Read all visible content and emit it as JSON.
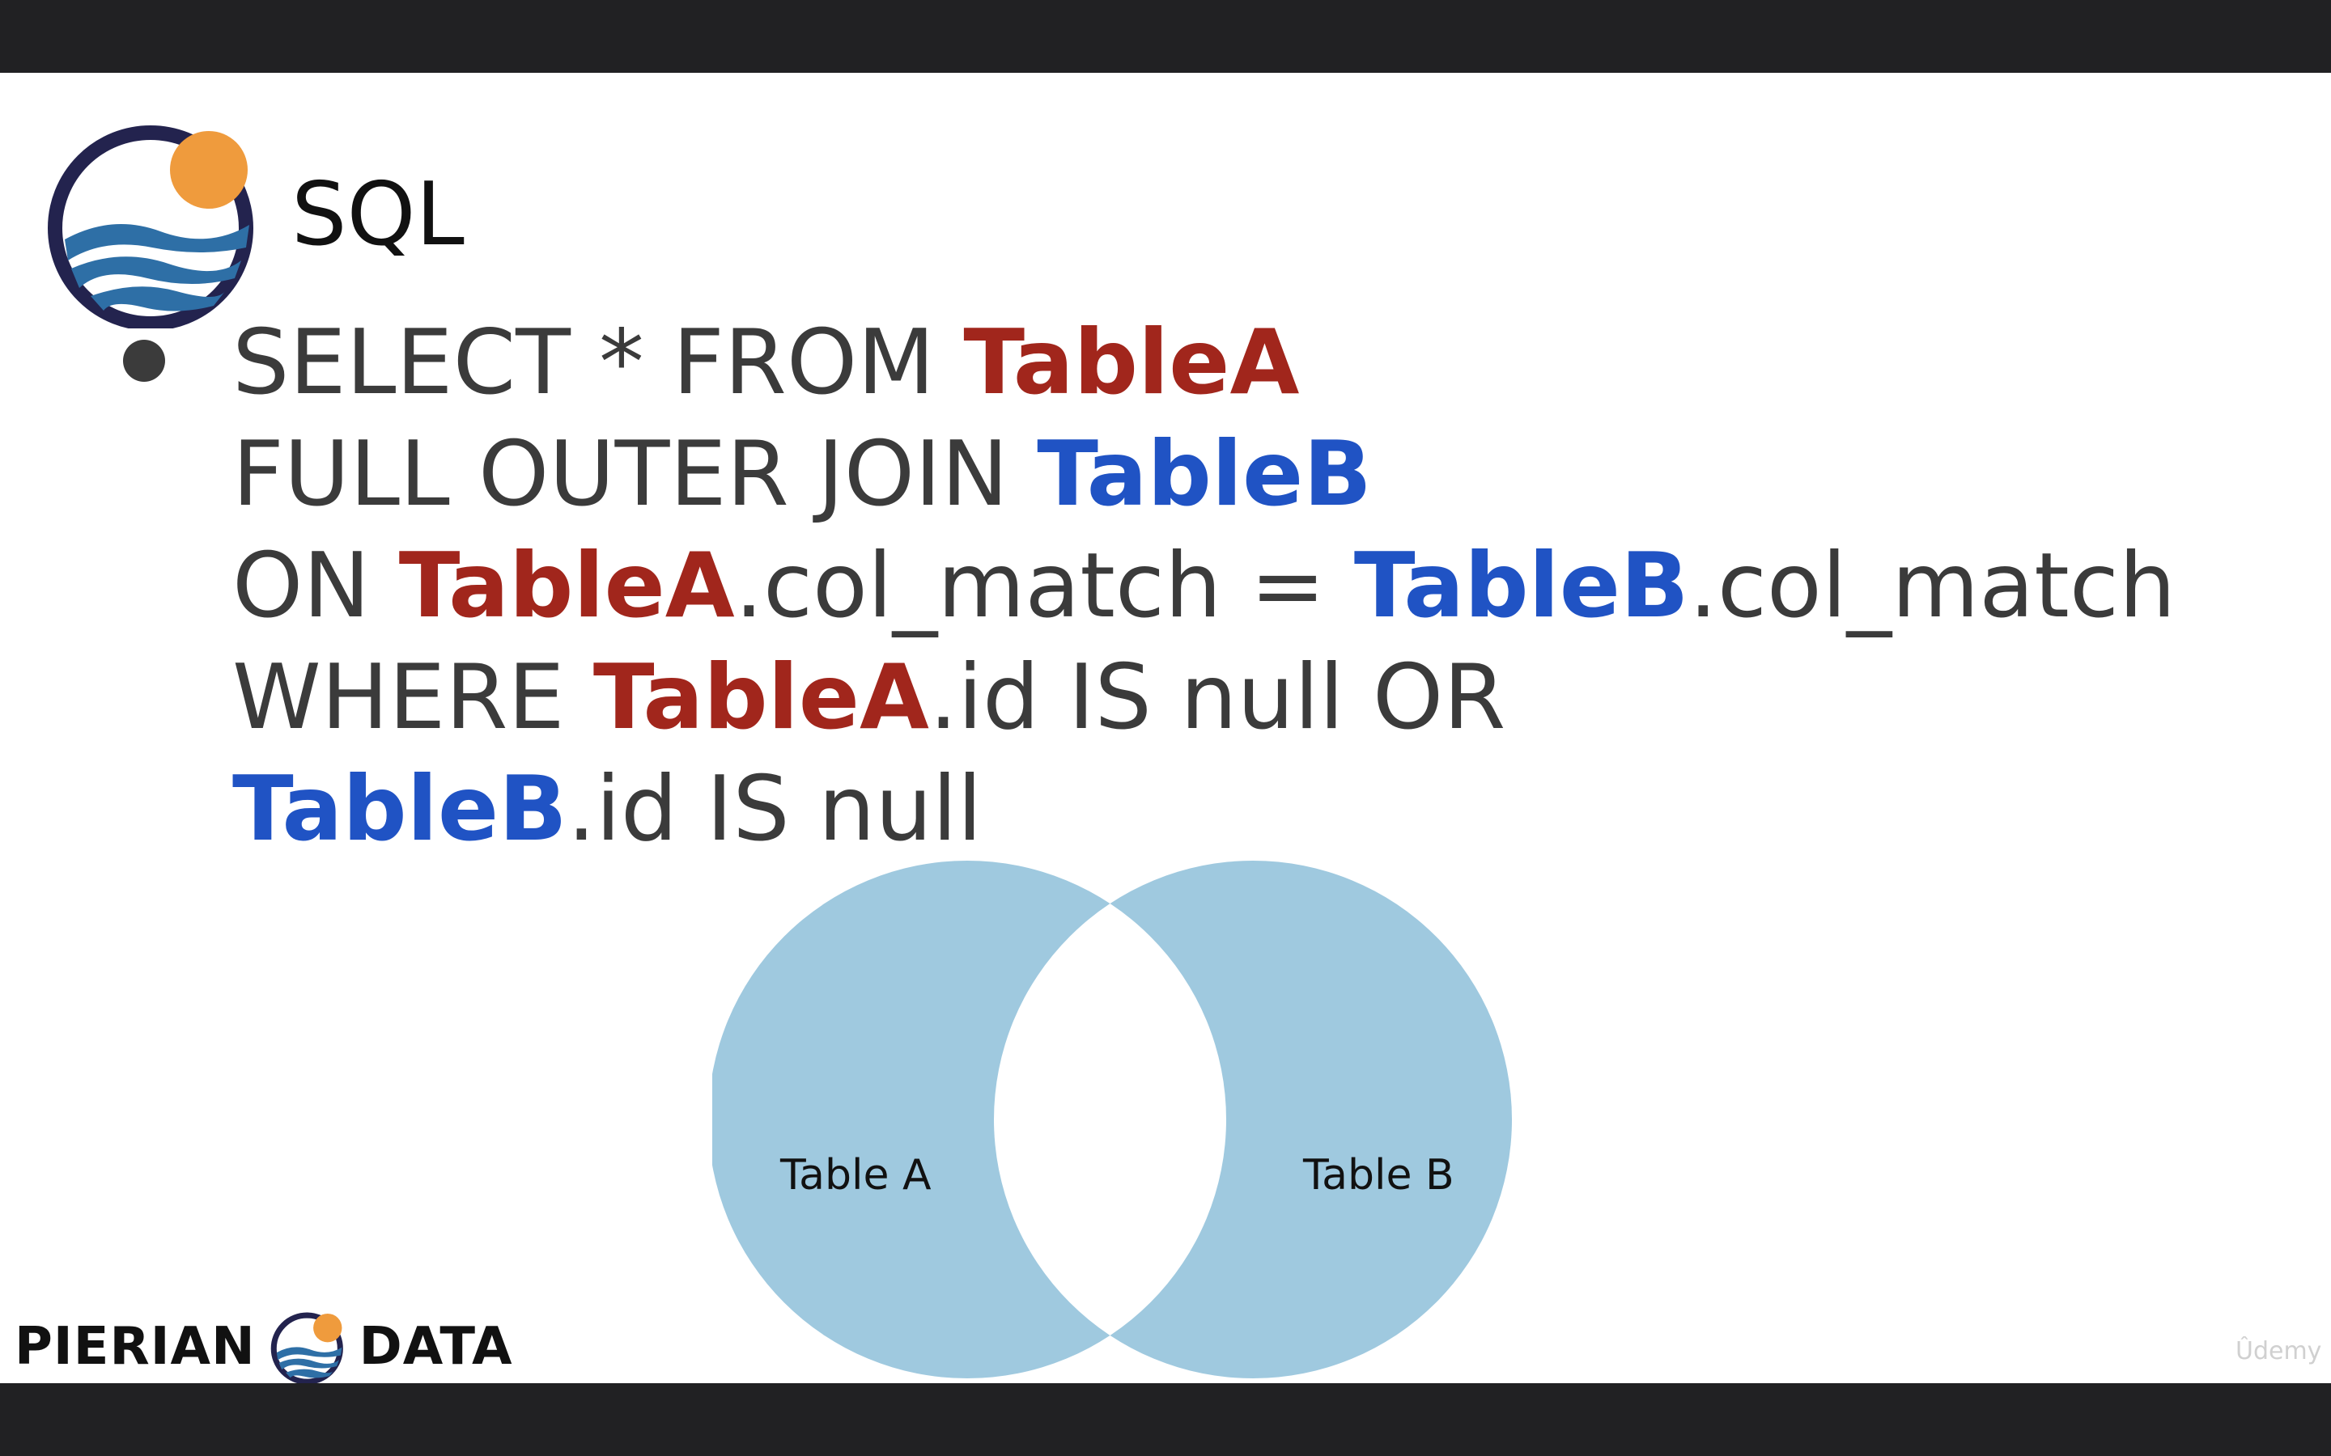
{
  "slide": {
    "title": "SQL",
    "code_lines": [
      [
        {
          "text": "SELECT * FROM ",
          "style": "plain"
        },
        {
          "text": "TableA",
          "style": "tA"
        }
      ],
      [
        {
          "text": "FULL OUTER JOIN ",
          "style": "plain"
        },
        {
          "text": "TableB",
          "style": "tB"
        }
      ],
      [
        {
          "text": "ON ",
          "style": "plain"
        },
        {
          "text": "TableA",
          "style": "tA"
        },
        {
          "text": ".col_match = ",
          "style": "plain"
        },
        {
          "text": "TableB",
          "style": "tB"
        },
        {
          "text": ".col_match",
          "style": "plain"
        }
      ],
      [
        {
          "text": "WHERE ",
          "style": "plain"
        },
        {
          "text": "TableA",
          "style": "tA"
        },
        {
          "text": ".id IS null OR",
          "style": "plain"
        }
      ],
      [
        {
          "text": "TableB",
          "style": "tB"
        },
        {
          "text": ".id IS null",
          "style": "plain"
        }
      ]
    ]
  },
  "venn": {
    "left_label": "Table A",
    "right_label": "Table B",
    "fill_color": "#9fc9df",
    "overlap_fill": "#ffffff"
  },
  "brand": {
    "left_word": "PIERIAN",
    "right_word": "DATA",
    "icon": "pierian-data-logo-icon"
  },
  "colors": {
    "tableA": "#a1261c",
    "tableB": "#2053c4",
    "text": "#3b3b3b",
    "logo_ring": "#23234e",
    "logo_sun": "#ef9b3d",
    "logo_wave": "#2e6fa6"
  },
  "watermark": "Ûdemy"
}
